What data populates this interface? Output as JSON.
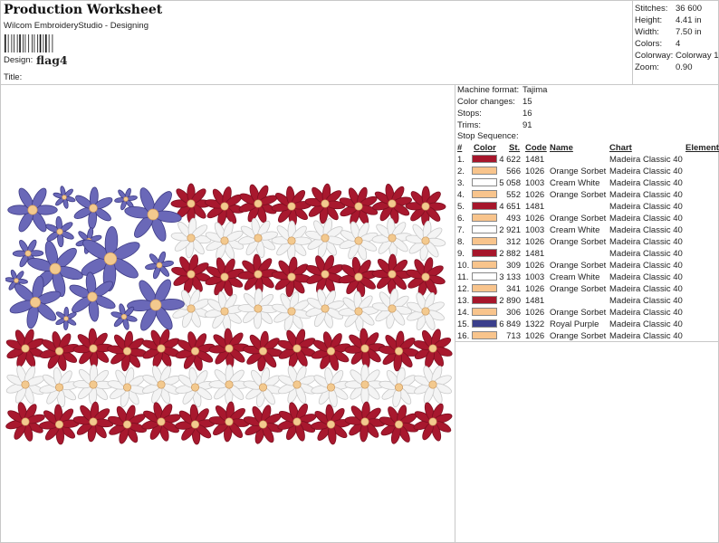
{
  "header": {
    "title": "Production Worksheet",
    "subtitle": "Wilcom EmbroideryStudio - Designing",
    "design_label": "Design:",
    "design_name": "flag4",
    "title_label": "Title:"
  },
  "info": [
    {
      "label": "Stitches:",
      "value": "36 600"
    },
    {
      "label": "Height:",
      "value": "4.41 in"
    },
    {
      "label": "Width:",
      "value": "7.50 in"
    },
    {
      "label": "Colors:",
      "value": "4"
    },
    {
      "label": "Colorway:",
      "value": "Colorway 1"
    },
    {
      "label": "Zoom:",
      "value": "0.90"
    }
  ],
  "machine": [
    {
      "label": "Machine format:",
      "value": "Tajima"
    },
    {
      "label": "Color changes:",
      "value": "15"
    },
    {
      "label": "Stops:",
      "value": "16"
    },
    {
      "label": "Trims:",
      "value": "91"
    }
  ],
  "stop_sequence": {
    "label": "Stop Sequence:",
    "headers": {
      "num": "#",
      "color": "Color",
      "st": "St.",
      "code": "Code",
      "name": "Name",
      "chart": "Chart",
      "element": "Element"
    },
    "rows": [
      {
        "num": "1.",
        "color": "#A6162B",
        "st": "4 622",
        "code": "1481",
        "name": "",
        "chart": "Madeira Classic 40"
      },
      {
        "num": "2.",
        "color": "#F8C48C",
        "st": "566",
        "code": "1026",
        "name": "Orange Sorbet",
        "chart": "Madeira Classic 40"
      },
      {
        "num": "3.",
        "color": "#FFFFFF",
        "st": "5 058",
        "code": "1003",
        "name": "Cream White",
        "chart": "Madeira Classic 40"
      },
      {
        "num": "4.",
        "color": "#F8C48C",
        "st": "552",
        "code": "1026",
        "name": "Orange Sorbet",
        "chart": "Madeira Classic 40"
      },
      {
        "num": "5.",
        "color": "#A6162B",
        "st": "4 651",
        "code": "1481",
        "name": "",
        "chart": "Madeira Classic 40"
      },
      {
        "num": "6.",
        "color": "#F8C48C",
        "st": "493",
        "code": "1026",
        "name": "Orange Sorbet",
        "chart": "Madeira Classic 40"
      },
      {
        "num": "7.",
        "color": "#FFFFFF",
        "st": "2 921",
        "code": "1003",
        "name": "Cream White",
        "chart": "Madeira Classic 40"
      },
      {
        "num": "8.",
        "color": "#F8C48C",
        "st": "312",
        "code": "1026",
        "name": "Orange Sorbet",
        "chart": "Madeira Classic 40"
      },
      {
        "num": "9.",
        "color": "#A6162B",
        "st": "2 882",
        "code": "1481",
        "name": "",
        "chart": "Madeira Classic 40"
      },
      {
        "num": "10.",
        "color": "#F8C48C",
        "st": "309",
        "code": "1026",
        "name": "Orange Sorbet",
        "chart": "Madeira Classic 40"
      },
      {
        "num": "11.",
        "color": "#FFFFFF",
        "st": "3 133",
        "code": "1003",
        "name": "Cream White",
        "chart": "Madeira Classic 40"
      },
      {
        "num": "12.",
        "color": "#F8C48C",
        "st": "341",
        "code": "1026",
        "name": "Orange Sorbet",
        "chart": "Madeira Classic 40"
      },
      {
        "num": "13.",
        "color": "#A6162B",
        "st": "2 890",
        "code": "1481",
        "name": "",
        "chart": "Madeira Classic 40"
      },
      {
        "num": "14.",
        "color": "#F8C48C",
        "st": "306",
        "code": "1026",
        "name": "Orange Sorbet",
        "chart": "Madeira Classic 40"
      },
      {
        "num": "15.",
        "color": "#3B3F8C",
        "st": "6 849",
        "code": "1322",
        "name": "Royal Purple",
        "chart": "Madeira Classic 40"
      },
      {
        "num": "16.",
        "color": "#F8C48C",
        "st": "713",
        "code": "1026",
        "name": "Orange Sorbet",
        "chart": "Madeira Classic 40"
      }
    ]
  },
  "design_colors": {
    "red": "#A8182E",
    "red_dark": "#7E0F20",
    "white": "#F4F4F4",
    "white_edge": "#C9C9C9",
    "purple": "#6A68B8",
    "purple_dark": "#3E3C86",
    "center": "#F3C98E",
    "center_edge": "#C9955A"
  }
}
